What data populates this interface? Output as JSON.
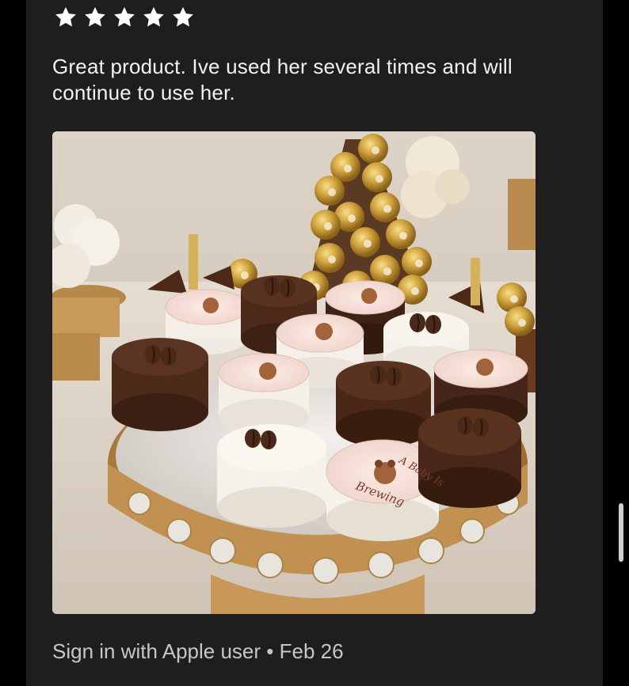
{
  "review": {
    "rating": 5,
    "rating_max": 5,
    "star_color": "#ffffff",
    "text": "Great product. Ive used her several times and will continue to use her.",
    "author": "Sign in with Apple user",
    "separator": "•",
    "date": "Feb 26"
  },
  "photo": {
    "topper_line1": "A Baby Is",
    "topper_line2": "Brewing"
  },
  "colors": {
    "page_background": "#000000",
    "card_background": "#1e1e1e",
    "text_primary": "#f2f2f2",
    "text_secondary": "#c7c7c7"
  }
}
